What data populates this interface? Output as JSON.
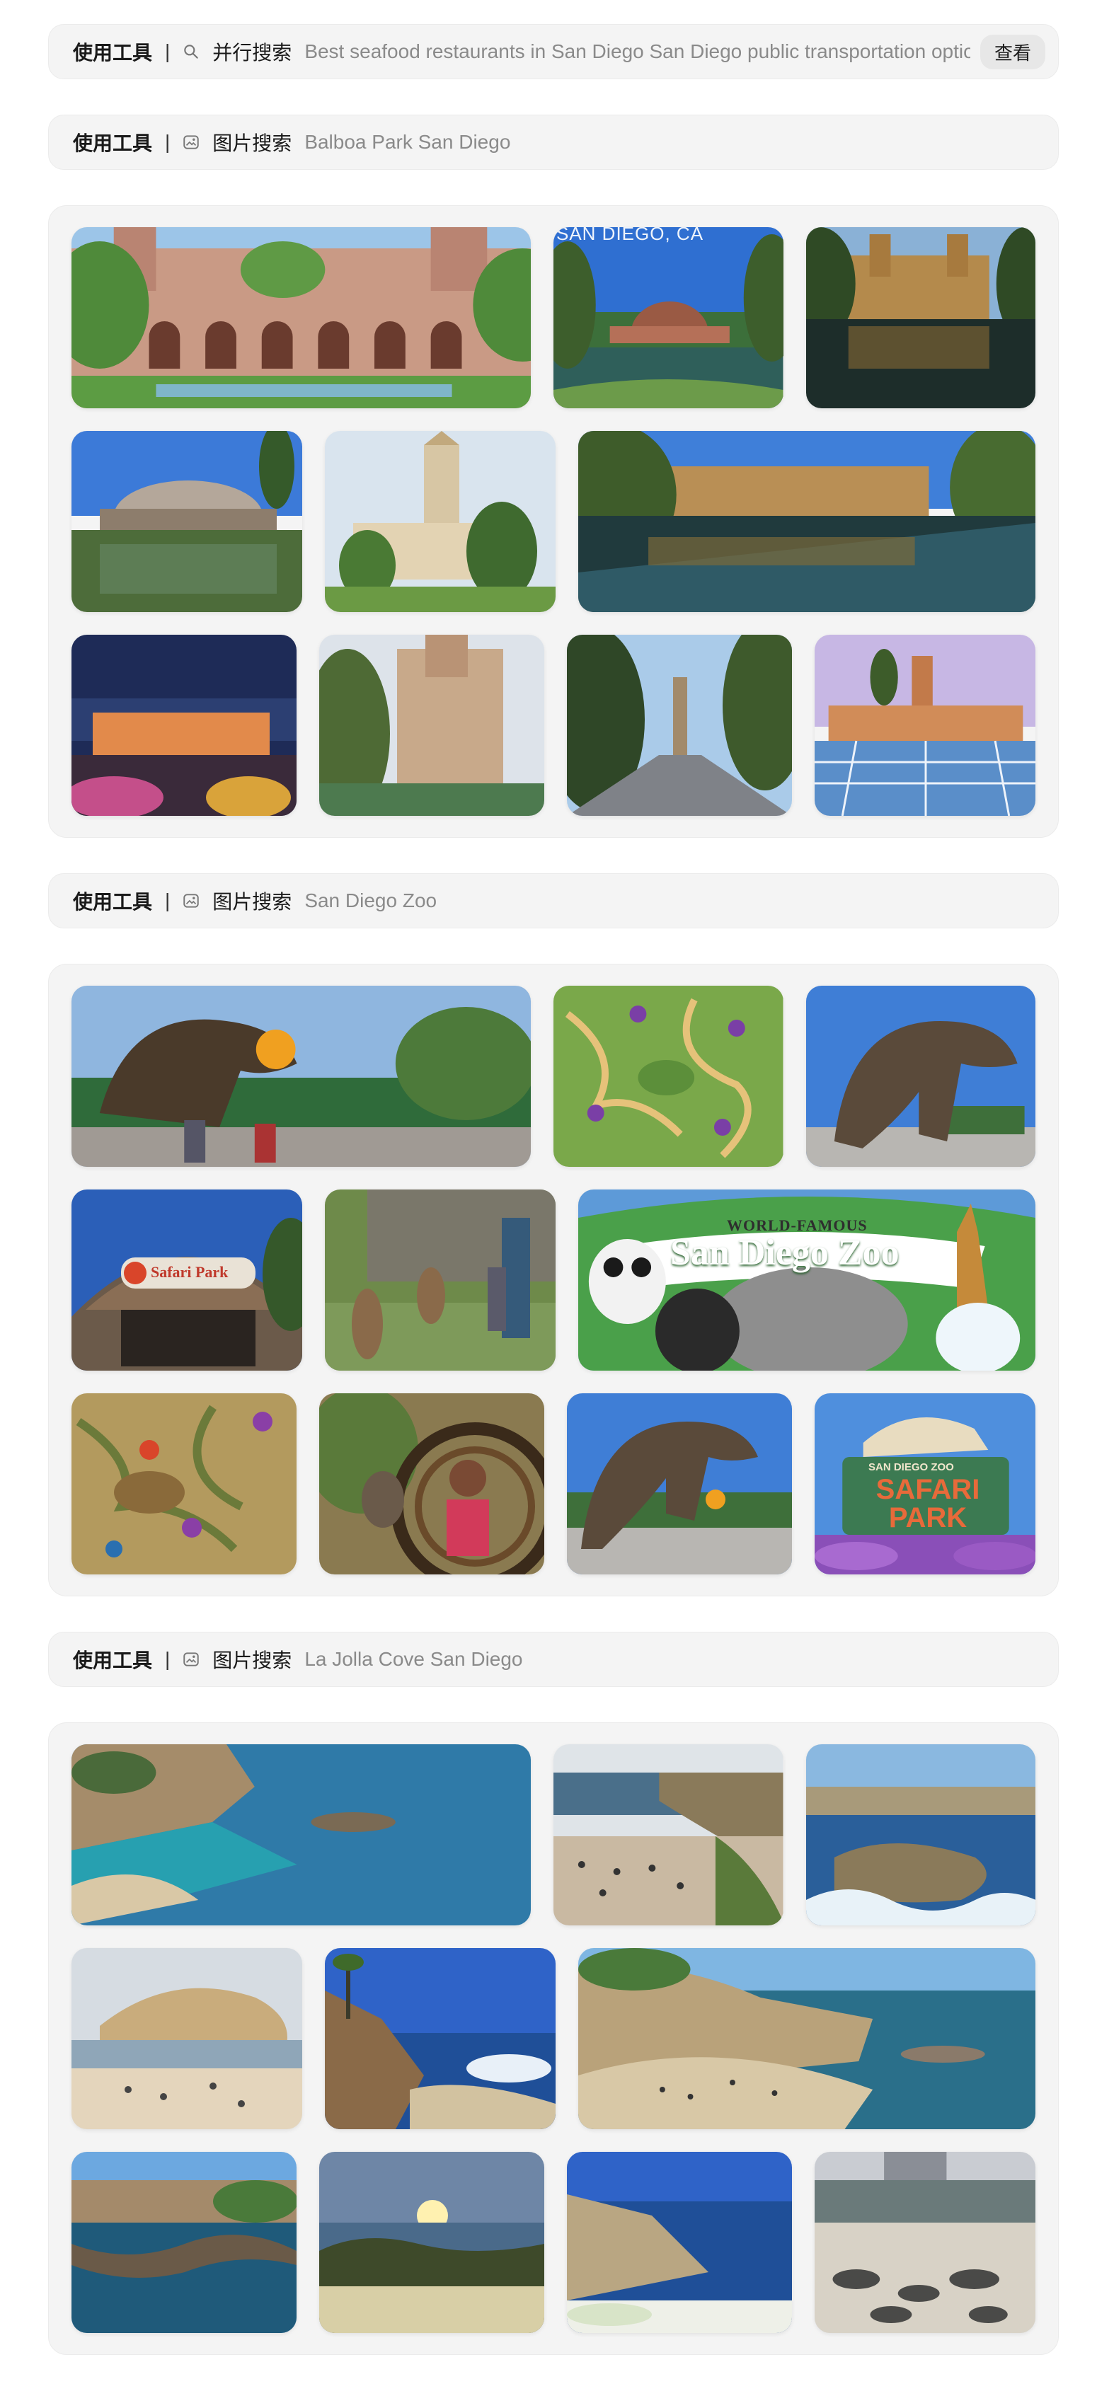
{
  "toolbars": [
    {
      "label": "使用工具",
      "separator": "|",
      "icon": "search-icon",
      "mode": "并行搜索",
      "query": "Best seafood restaurants in San Diego San Diego public transportation options",
      "action": "查看"
    },
    {
      "label": "使用工具",
      "separator": "|",
      "icon": "image-search-icon",
      "mode": "图片搜索",
      "query": "Balboa Park San Diego"
    },
    {
      "label": "使用工具",
      "separator": "|",
      "icon": "image-search-icon",
      "mode": "图片搜索",
      "query": "San Diego Zoo"
    },
    {
      "label": "使用工具",
      "separator": "|",
      "icon": "image-search-icon",
      "mode": "图片搜索",
      "query": "La Jolla Cove San Diego"
    }
  ],
  "galleries": {
    "balboa": {
      "first_caption": "SAN DIEGO, CA"
    },
    "zoo": {
      "sign_top": "WORLD-FAMOUS",
      "sign_main": "San Diego Zoo",
      "entrance_sign": "Safari Park",
      "safari_sign_top": "SAN DIEGO ZOO",
      "safari_sign": "SAFARI PARK"
    }
  },
  "colors": {
    "panel_bg": "#f4f4f4",
    "query_text": "#8a8a8a"
  }
}
